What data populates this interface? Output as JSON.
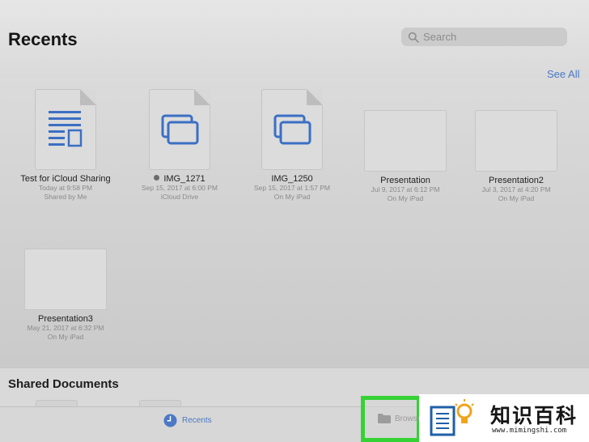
{
  "header": {
    "title": "Recents",
    "search_placeholder": "Search",
    "see_all": "See All"
  },
  "recents": [
    {
      "name": "Test for iCloud Sharing",
      "date": "Today at 9:58 PM",
      "location": "Shared by Me",
      "kind": "document"
    },
    {
      "name": "IMG_1271",
      "date": "Sep 15, 2017 at 6:00 PM",
      "location": "iCloud Drive",
      "kind": "image",
      "status_dot": true
    },
    {
      "name": "IMG_1250",
      "date": "Sep 15, 2017 at 1:57 PM",
      "location": "On My iPad",
      "kind": "image"
    },
    {
      "name": "Presentation",
      "date": "Jul 9, 2017 at 6:12 PM",
      "location": "On My iPad",
      "kind": "presentation"
    },
    {
      "name": "Presentation2",
      "date": "Jul 3, 2017 at 4:20 PM",
      "location": "On My iPad",
      "kind": "presentation"
    },
    {
      "name": "Presentation3",
      "date": "May 21, 2017 at 6:32 PM",
      "location": "On My iPad",
      "kind": "presentation"
    }
  ],
  "shared": {
    "title": "Shared Documents"
  },
  "tabbar": {
    "recents_label": "Recents",
    "browse_label": "Browse"
  },
  "watermark": {
    "text_cn": "知识百科",
    "url": "www.mimingshi.com"
  },
  "colors": {
    "accent": "#4b79c4",
    "highlight": "#35d235"
  }
}
